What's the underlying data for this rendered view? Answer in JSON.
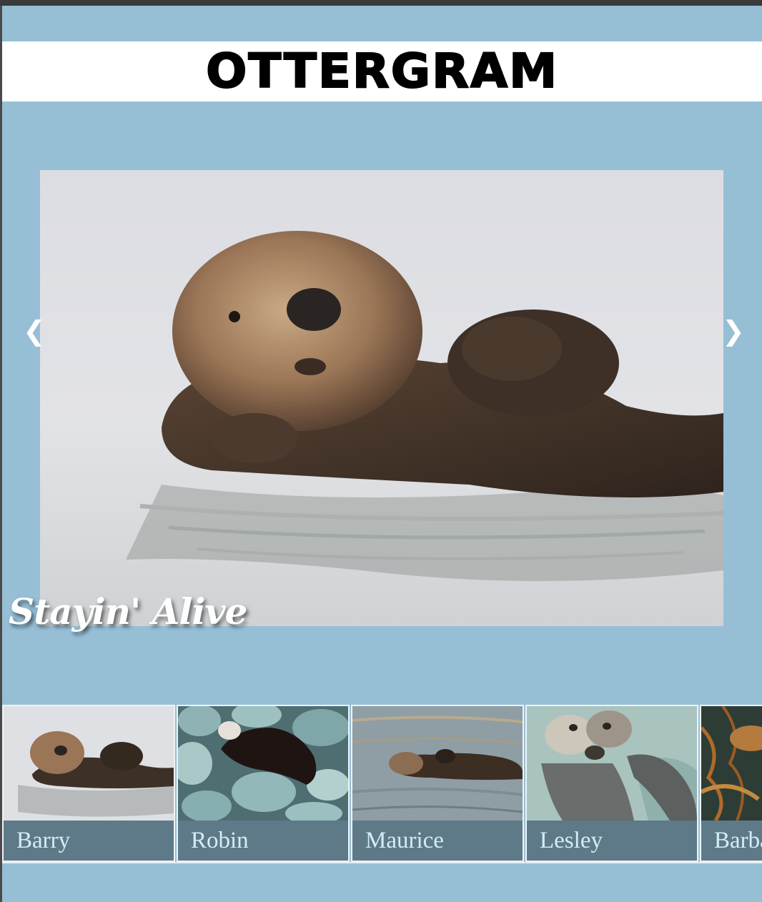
{
  "header": {
    "title": "OTTERGRAM"
  },
  "detail": {
    "title": "Stayin' Alive",
    "prev_icon": "❮",
    "next_icon": "❯",
    "image_icon": "otter-floating-photo"
  },
  "thumbnails": [
    {
      "label": "Barry",
      "image_icon": "otter-floating-photo"
    },
    {
      "label": "Robin",
      "image_icon": "otter-on-rocks-photo"
    },
    {
      "label": "Maurice",
      "image_icon": "otter-swimming-photo"
    },
    {
      "label": "Lesley",
      "image_icon": "otters-holding-hands-photo"
    },
    {
      "label": "Barbara",
      "image_icon": "otter-in-kelp-photo"
    }
  ],
  "colors": {
    "background": "#96bfd6",
    "thumb_label_bg": "#5e7a88",
    "thumb_label_text": "#d6ecf5"
  }
}
